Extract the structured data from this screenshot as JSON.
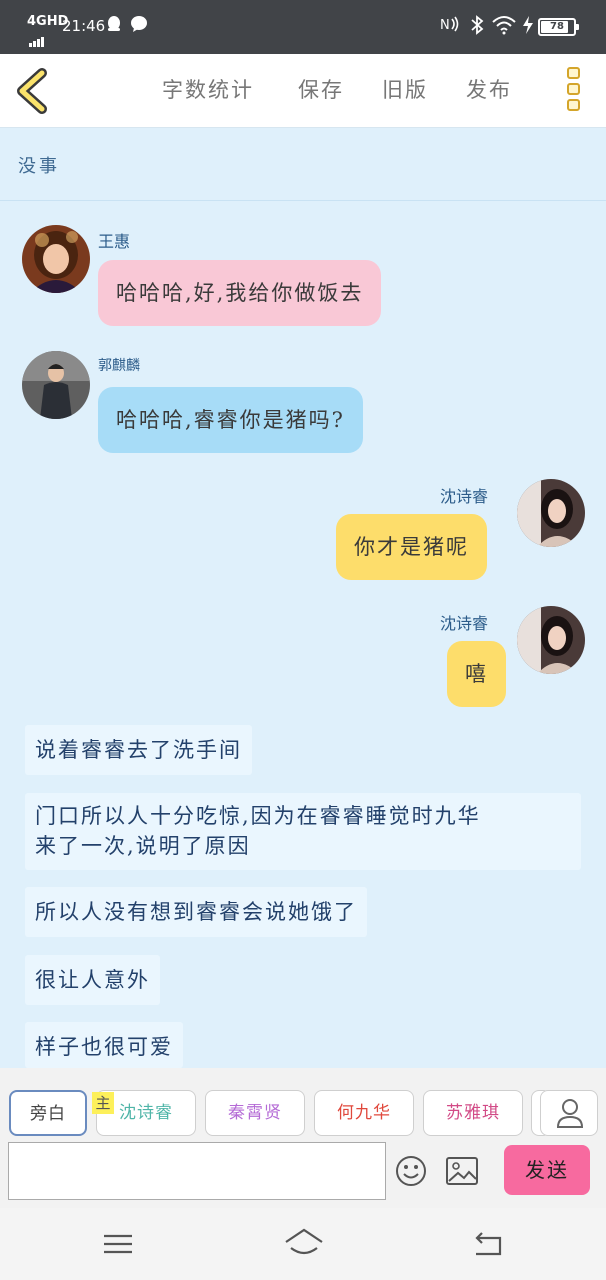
{
  "status_bar": {
    "network": "4GHD",
    "time": "21:46",
    "battery": "78",
    "battery_level": 0.78
  },
  "toolbar": {
    "word_count": "字数统计",
    "save": "保存",
    "old_version": "旧版",
    "publish": "发布"
  },
  "story": {
    "title": "没事"
  },
  "messages": [
    {
      "speaker": "王惠",
      "text": "哈哈哈,好,我给你做饭去",
      "style": "pink",
      "side": "left"
    },
    {
      "speaker": "郭麒麟",
      "text": "哈哈哈,睿睿你是猪吗?",
      "style": "blue",
      "side": "left"
    },
    {
      "speaker": "沈诗睿",
      "text": "你才是猪呢",
      "style": "yellow",
      "side": "right"
    },
    {
      "speaker": "沈诗睿",
      "text": "嘻",
      "style": "yellow",
      "side": "right"
    }
  ],
  "narrations": [
    "说着睿睿去了洗手间",
    "门口所以人十分吃惊,因为在睿睿睡觉时九华",
    "来了一次,说明了原因",
    "所以人没有想到睿睿会说她饿了",
    "很让人意外",
    "样子也很可爱"
  ],
  "characters": {
    "narrator": "旁白",
    "main_badge": "主",
    "list": [
      {
        "name": "沈诗睿",
        "color": "#4fb5a8"
      },
      {
        "name": "秦霄贤",
        "color": "#b56bd6"
      },
      {
        "name": "何九华",
        "color": "#e0483c"
      },
      {
        "name": "苏雅琪",
        "color": "#d24a86"
      }
    ]
  },
  "input": {
    "placeholder": "",
    "send": "发送"
  },
  "colors": {
    "accent_pink": "#f76a9f",
    "bubble_pink": "#f9c8d6",
    "bubble_blue": "#a7dcf7",
    "bubble_yellow": "#fddd6b",
    "background": "#dff0fb"
  }
}
